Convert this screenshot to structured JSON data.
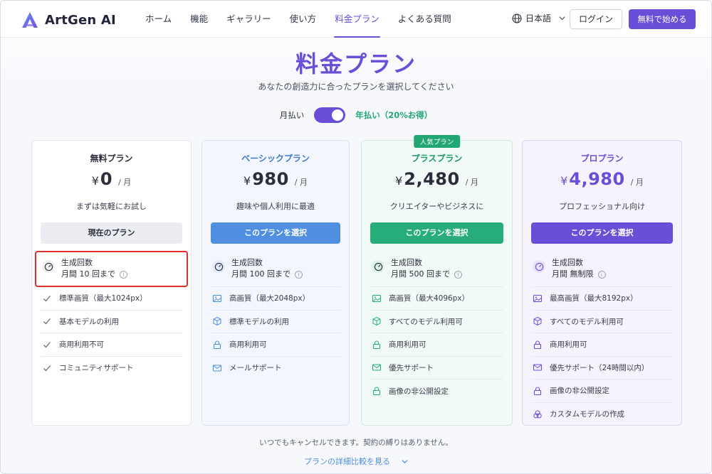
{
  "app": {
    "name": "ArtGen AI"
  },
  "nav": [
    {
      "label": "ホーム",
      "active": false
    },
    {
      "label": "機能",
      "active": false
    },
    {
      "label": "ギャラリー",
      "active": false
    },
    {
      "label": "使い方",
      "active": false
    },
    {
      "label": "料金プラン",
      "active": true
    },
    {
      "label": "よくある質問",
      "active": false
    }
  ],
  "header": {
    "language": "日本語",
    "login": "ログイン",
    "start": "無料で始める"
  },
  "hero": {
    "title": "料金プラン",
    "subtitle": "あなたの創造力に合ったプランを選択してください"
  },
  "billing": {
    "monthly": "月払い",
    "yearly": "年払い（20%お得）",
    "yearly_selected": true
  },
  "plans": [
    {
      "name": "無料プラン",
      "currency": "¥",
      "price": "0",
      "per": "/ 月",
      "desc": "まずは気軽にお試し",
      "cta": "現在のプラン",
      "main_feature": {
        "label": "生成回数",
        "value": "月間 10 回まで",
        "info": "i"
      },
      "features": [
        {
          "icon": "check-icon",
          "label": "標準画質（最大1024px）"
        },
        {
          "icon": "check-icon",
          "label": "基本モデルの利用"
        },
        {
          "icon": "check-icon",
          "label": "商用利用不可"
        },
        {
          "icon": "check-icon",
          "label": "コミュニティサポート"
        }
      ]
    },
    {
      "name": "ベーシックプラン",
      "currency": "¥",
      "price": "980",
      "per": "/ 月",
      "desc": "趣味や個人利用に最適",
      "cta": "このプランを選択",
      "main_feature": {
        "label": "生成回数",
        "value": "月間 100 回まで",
        "info": "i"
      },
      "features": [
        {
          "icon": "image-icon",
          "label": "高画質（最大2048px）"
        },
        {
          "icon": "cube-icon",
          "label": "標準モデルの利用"
        },
        {
          "icon": "lock-icon",
          "label": "商用利用可"
        },
        {
          "icon": "mail-icon",
          "label": "メールサポート"
        }
      ]
    },
    {
      "name": "プラスプラン",
      "badge": "人気プラン",
      "currency": "¥",
      "price": "2,480",
      "per": "/ 月",
      "desc": "クリエイターやビジネスに",
      "cta": "このプランを選択",
      "main_feature": {
        "label": "生成回数",
        "value": "月間 500 回まで",
        "info": "i"
      },
      "features": [
        {
          "icon": "image-icon",
          "label": "高画質（最大4096px）"
        },
        {
          "icon": "cube-icon",
          "label": "すべてのモデル利用可"
        },
        {
          "icon": "lock-icon",
          "label": "商用利用可"
        },
        {
          "icon": "mail-icon",
          "label": "優先サポート"
        },
        {
          "icon": "lock-icon",
          "label": "画像の非公開設定"
        }
      ]
    },
    {
      "name": "プロプラン",
      "currency": "¥",
      "price": "4,980",
      "per": "/ 月",
      "desc": "プロフェッショナル向け",
      "cta": "このプランを選択",
      "main_feature": {
        "label": "生成回数",
        "value": "月間 無制限",
        "info": "i"
      },
      "features": [
        {
          "icon": "image-icon",
          "label": "最高画質（最大8192px）"
        },
        {
          "icon": "cube-icon",
          "label": "すべてのモデル利用可"
        },
        {
          "icon": "lock-icon",
          "label": "商用利用可"
        },
        {
          "icon": "mail-icon",
          "label": "優先サポート（24時間以内）"
        },
        {
          "icon": "lock-icon",
          "label": "画像の非公開設定"
        },
        {
          "icon": "palette-icon",
          "label": "カスタムモデルの作成"
        }
      ]
    }
  ],
  "footer": {
    "note": "いつでもキャンセルできます。契約の縛りはありません。",
    "compare": "プランの詳細比較を見る"
  },
  "colors": {
    "brand": "#6a4ed8",
    "basic": "#4f8ee0",
    "plus": "#26ad7a",
    "highlight": "#e0302a"
  }
}
